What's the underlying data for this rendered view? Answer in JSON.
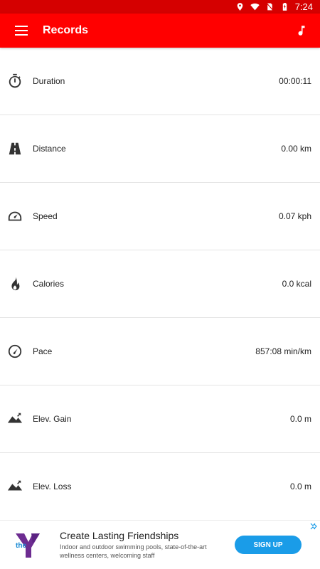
{
  "status_bar": {
    "time": "7:24",
    "icons": [
      "location-icon",
      "wifi-icon",
      "no-sim-icon",
      "battery-charging-icon"
    ]
  },
  "app_bar": {
    "title": "Records",
    "menu_icon": "menu-icon",
    "music_icon": "music-note-icon"
  },
  "records": [
    {
      "icon": "stopwatch-icon",
      "label": "Duration",
      "value": "00:00:11"
    },
    {
      "icon": "road-icon",
      "label": "Distance",
      "value": "0.00 km"
    },
    {
      "icon": "speedometer-icon",
      "label": "Speed",
      "value": "0.07 kph"
    },
    {
      "icon": "flame-icon",
      "label": "Calories",
      "value": "0.0 kcal"
    },
    {
      "icon": "pace-dial-icon",
      "label": "Pace",
      "value": "857:08 min/km"
    },
    {
      "icon": "mountain-up-icon",
      "label": "Elev. Gain",
      "value": "0.0 m"
    },
    {
      "icon": "mountain-down-icon",
      "label": "Elev. Loss",
      "value": "0.0 m"
    }
  ],
  "ad": {
    "logo_text": "the",
    "headline": "Create Lasting Friendships",
    "body": "Indoor and outdoor swimming pools, state-of-the-art wellness centers, welcoming staff",
    "cta": "SIGN UP"
  },
  "colors": {
    "status_bar": "#d50000",
    "app_bar": "#ff0000",
    "cta": "#1a9ce8"
  }
}
